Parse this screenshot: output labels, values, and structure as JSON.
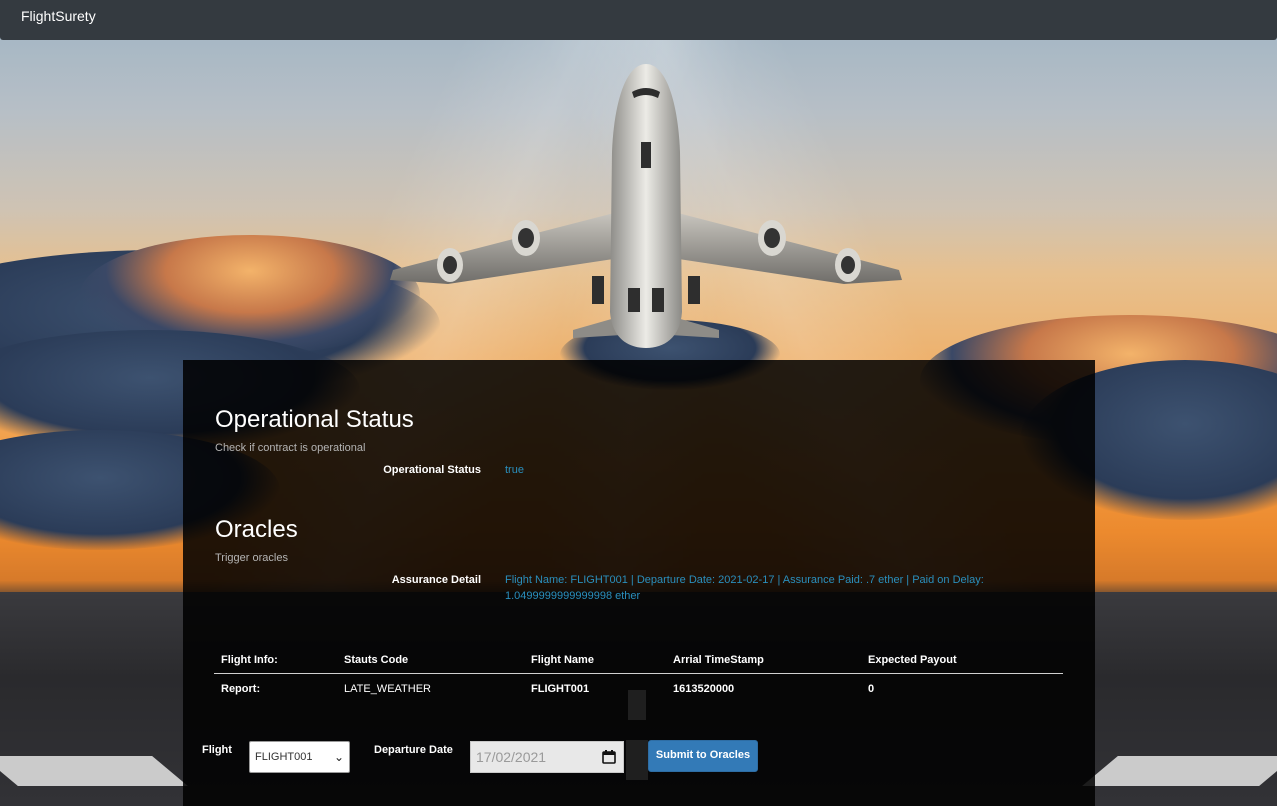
{
  "app": {
    "brand": "FlightSurety"
  },
  "operational": {
    "title": "Operational Status",
    "subtitle": "Check if contract is operational",
    "label": "Operational Status",
    "value": "true"
  },
  "oracles": {
    "title": "Oracles",
    "subtitle": "Trigger oracles",
    "assurance_label": "Assurance Detail",
    "assurance_value": "Flight Name: FLIGHT001 | Departure Date: 2021-02-17 | Assurance Paid: .7 ether | Paid on Delay: 1.0499999999999998 ether"
  },
  "report_table": {
    "headers": [
      "Flight Info:",
      "Stauts Code",
      "Flight Name",
      "Arrial TimeStamp",
      "Expected Payout"
    ],
    "rows": [
      [
        "Report:",
        "LATE_WEATHER",
        "FLIGHT001",
        "1613520000",
        "0"
      ]
    ]
  },
  "form": {
    "flight_label": "Flight",
    "flight_selected": "FLIGHT001",
    "date_label": "Departure Date",
    "date_value": "17/02/2021",
    "submit_label": "Submit to Oracles"
  },
  "icons": {
    "select": "chevron-down-icon",
    "date": "calendar-icon"
  },
  "colors": {
    "navbar": "#343a40",
    "accent_text": "#2a8fbd",
    "button": "#337ab7"
  }
}
